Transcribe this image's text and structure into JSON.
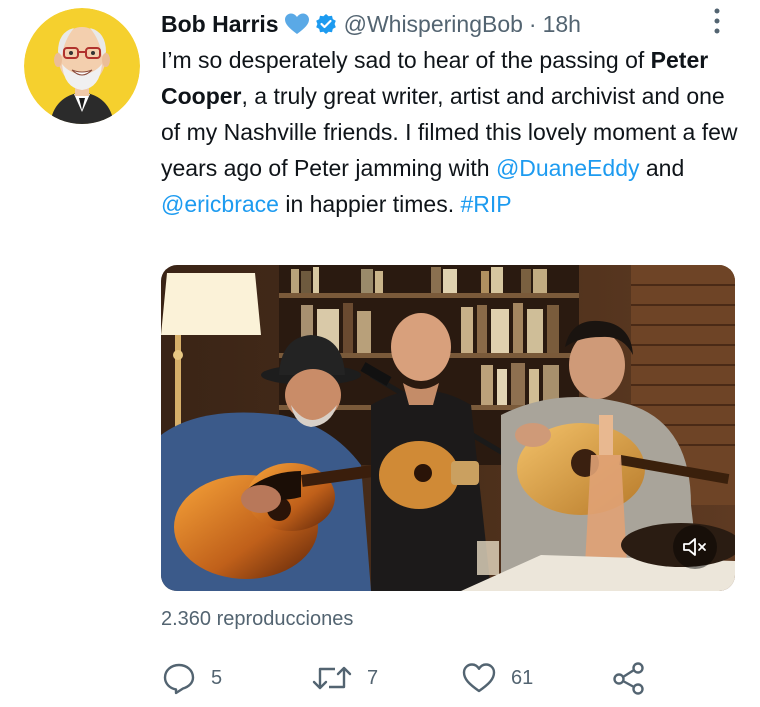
{
  "author": {
    "name": "Bob Harris",
    "handle": "@WhisperingBob",
    "separator": "·",
    "time": "18h",
    "verified": true
  },
  "tweet": {
    "line1": "I’m so desperately sad to hear of the passing of ",
    "bold_name": "Peter Cooper",
    "line2": ", a truly great writer, artist and archivist and one of my Nashville friends. I filmed this lovely moment a few years ago of Peter jamming with ",
    "mention1": "@DuaneEddy",
    "and_text": " and ",
    "mention2": "@ericbrace",
    "line3": " in happier times. ",
    "hashtag": "#RIP"
  },
  "video": {
    "muted": true
  },
  "views": "2.360 reproducciones",
  "actions": {
    "replies": "5",
    "retweets": "7",
    "likes": "61"
  },
  "colors": {
    "link": "#1d9bf0",
    "secondary_text": "#536471",
    "avatar_bg": "#f5d02e",
    "emoji_heart": "#5aa9e6"
  }
}
